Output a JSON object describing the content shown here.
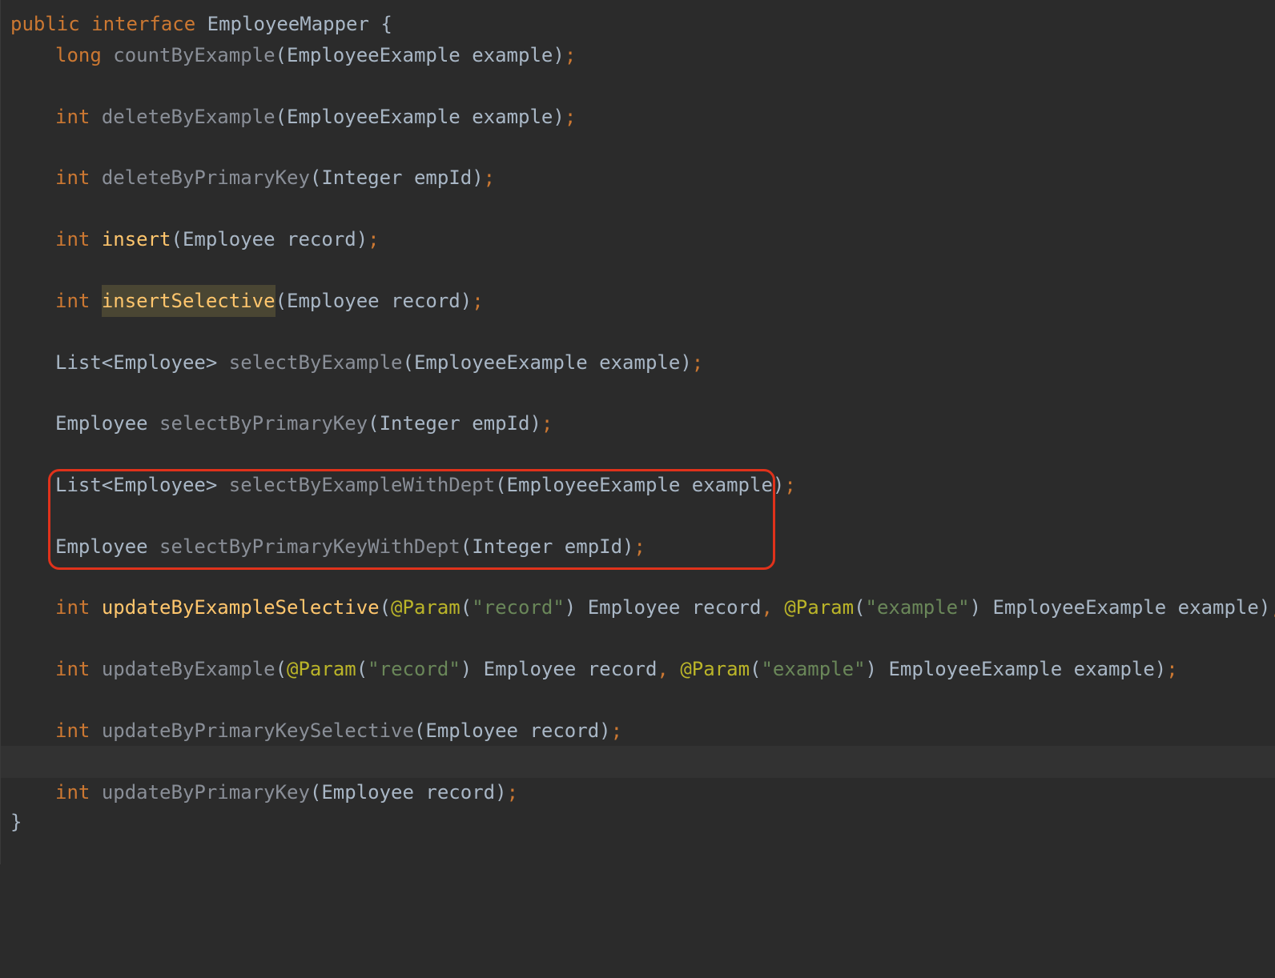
{
  "editor": {
    "header": {
      "public": "public",
      "interface": "interface",
      "name": "EmployeeMapper",
      "brace": "{"
    },
    "footer": {
      "brace": "}"
    },
    "methods": [
      {
        "ret": "long",
        "name": "countByExample",
        "open": "(",
        "ptype": "EmployeeExample",
        "pname": "example",
        "close": ")",
        "semi": ";"
      },
      {
        "ret": "int",
        "name": "deleteByExample",
        "open": "(",
        "ptype": "EmployeeExample",
        "pname": "example",
        "close": ")",
        "semi": ";"
      },
      {
        "ret": "int",
        "name": "deleteByPrimaryKey",
        "open": "(",
        "ptype": "Integer",
        "pname": "empId",
        "close": ")",
        "semi": ";"
      },
      {
        "ret": "int",
        "name": "insert",
        "open": "(",
        "ptype": "Employee",
        "pname": "record",
        "close": ")",
        "semi": ";"
      },
      {
        "ret": "int",
        "name": "insertSelective",
        "open": "(",
        "ptype": "Employee",
        "pname": "record",
        "close": ")",
        "semi": ";"
      },
      {
        "ret": "List<Employee>",
        "name": "selectByExample",
        "open": "(",
        "ptype": "EmployeeExample",
        "pname": "example",
        "close": ")",
        "semi": ";"
      },
      {
        "ret": "Employee",
        "name": "selectByPrimaryKey",
        "open": "(",
        "ptype": "Integer",
        "pname": "empId",
        "close": ")",
        "semi": ";"
      },
      {
        "ret": "List<Employee>",
        "name": "selectByExampleWithDept",
        "open": "(",
        "ptype": "EmployeeExample",
        "pname": "example",
        "close": ")",
        "semi": ";"
      },
      {
        "ret": "Employee",
        "name": "selectByPrimaryKeyWithDept",
        "open": "(",
        "ptype": "Integer",
        "pname": "empId",
        "close": ")",
        "semi": ";"
      },
      {
        "ret": "int",
        "name": "updateByExampleSelective",
        "open": "(",
        "ann1": "@Param",
        "lp1": "(",
        "str1": "\"record\"",
        "rp1": ")",
        "ptype1": "Employee",
        "pname1": "record",
        "comma": ",",
        "ann2": "@Param",
        "lp2": "(",
        "str2": "\"example\"",
        "rp2": ")",
        "ptype2": "EmployeeExample",
        "pname2": "example",
        "close": ")",
        "semi": ";"
      },
      {
        "ret": "int",
        "name": "updateByExample",
        "open": "(",
        "ann1": "@Param",
        "lp1": "(",
        "str1": "\"record\"",
        "rp1": ")",
        "ptype1": "Employee",
        "pname1": "record",
        "comma": ",",
        "ann2": "@Param",
        "lp2": "(",
        "str2": "\"example\"",
        "rp2": ")",
        "ptype2": "EmployeeExample",
        "pname2": "example",
        "close": ")",
        "semi": ";"
      },
      {
        "ret": "int",
        "name": "updateByPrimaryKeySelective",
        "open": "(",
        "ptype": "Employee",
        "pname": "record",
        "close": ")",
        "semi": ";"
      },
      {
        "ret": "int",
        "name": "updateByPrimaryKey",
        "open": "(",
        "ptype": "Employee",
        "pname": "record",
        "close": ")",
        "semi": ";"
      }
    ],
    "colors": {
      "background": "#2b2b2b",
      "keyword": "#cc7832",
      "declared_method": "#ffc66d",
      "unused_method": "#8a8f98",
      "annotation": "#bbb529",
      "string": "#6a8759",
      "identifier": "#a9b7c6",
      "annotation_box": "#e0321b",
      "usage_highlight": "#4a4633"
    }
  }
}
